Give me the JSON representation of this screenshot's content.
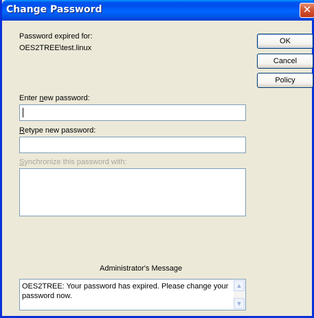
{
  "window": {
    "title": "Change Password",
    "close_glyph": "✕"
  },
  "info": {
    "expired_label": "Password expired for:",
    "account": "OES2TREE\\test.linux"
  },
  "buttons": {
    "ok": "OK",
    "cancel": "Cancel",
    "policy": "Policy"
  },
  "fields": {
    "new_password_label_pre": "Enter ",
    "new_password_label_accel": "n",
    "new_password_label_post": "ew password:",
    "new_password_value": "",
    "retype_label_accel": "R",
    "retype_label_post": "etype new password:",
    "retype_value": "",
    "sync_label_accel": "S",
    "sync_label_post": "ynchronize this password with:"
  },
  "admin": {
    "heading": "Administrator's Message",
    "message": "OES2TREE: Your password has expired. Please change your password now."
  },
  "icons": {
    "close": "close-icon",
    "scroll_up": "chevron-up-icon",
    "scroll_down": "chevron-down-icon"
  },
  "colors": {
    "titlebar": "#0053ee",
    "frame": "#0831d9",
    "close": "#d55a38",
    "dialog_bg": "#ece9d8",
    "input_border": "#7f9db9"
  }
}
